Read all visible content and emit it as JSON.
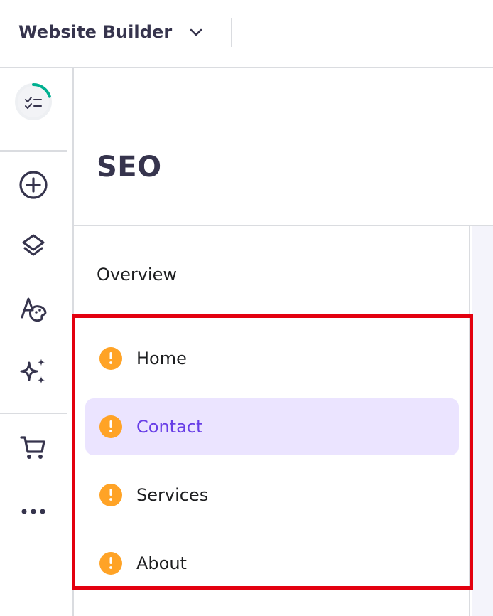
{
  "header": {
    "app_title": "Website Builder",
    "switcher_icon": "chevron-down-icon"
  },
  "rail": {
    "items": [
      {
        "name": "progress-checklist",
        "icon": "checklist-icon",
        "progress_percent": 20,
        "progress_color": "#00b090"
      },
      {
        "name": "add-element",
        "icon": "plus-circle-icon"
      },
      {
        "name": "layers",
        "icon": "layers-icon"
      },
      {
        "name": "styles",
        "icon": "text-palette-icon"
      },
      {
        "name": "ai-tools",
        "icon": "sparkles-icon"
      },
      {
        "name": "store",
        "icon": "cart-icon"
      },
      {
        "name": "more",
        "icon": "more-horizontal-icon"
      }
    ]
  },
  "panel": {
    "title": "SEO",
    "overview_label": "Overview",
    "pages": [
      {
        "label": "Home",
        "status_icon": "warning-icon",
        "active": false
      },
      {
        "label": "Contact",
        "status_icon": "warning-icon",
        "active": true
      },
      {
        "label": "Services",
        "status_icon": "warning-icon",
        "active": false
      },
      {
        "label": "About",
        "status_icon": "warning-icon",
        "active": false
      }
    ]
  },
  "colors": {
    "accent": "#673de6",
    "active_bg": "#ebe4ff",
    "warning": "#ffa326",
    "highlight": "#e3000f",
    "text_dark": "#36344d"
  }
}
